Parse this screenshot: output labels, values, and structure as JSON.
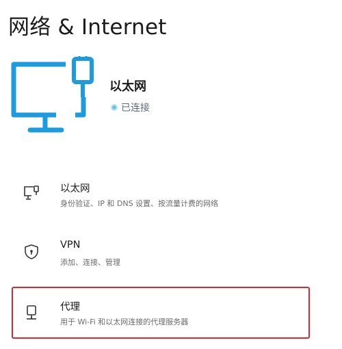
{
  "page": {
    "title": "网络 & Internet"
  },
  "hero": {
    "icon": "ethernet-monitor-icon",
    "name": "以太网",
    "status": "已连接",
    "accent_color": "#1e9bdc",
    "status_color": "#6ec3e6"
  },
  "items": [
    {
      "icon": "ethernet-icon",
      "title": "以太网",
      "description": "身份验证、IP 和 DNS 设置、按流量计费的网络"
    },
    {
      "icon": "shield-icon",
      "title": "VPN",
      "description": "添加、连接、管理"
    },
    {
      "icon": "proxy-icon",
      "title": "代理",
      "description": "用于 Wi-Fi 和以太网连接的代理服务器",
      "highlight_color": "#e0252c"
    }
  ]
}
